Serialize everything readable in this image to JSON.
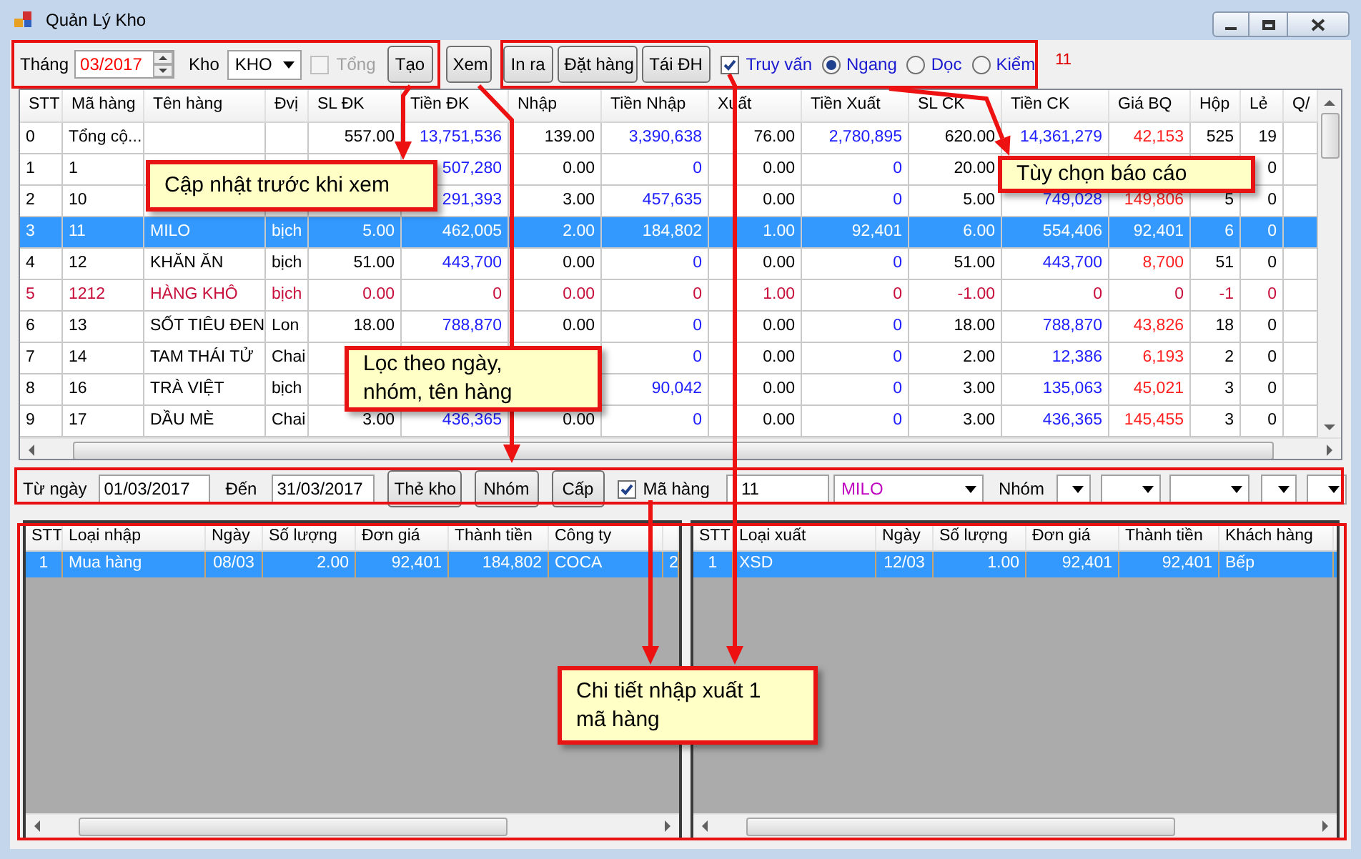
{
  "window": {
    "title": "Quản Lý Kho"
  },
  "toolbar": {
    "month_label": "Tháng",
    "month_value": "03/2017",
    "store_label": "Kho",
    "store_value": "KHO",
    "total": {
      "label": "Tổng",
      "checked": false,
      "disabled": true
    },
    "buttons": [
      "Tạo",
      "Xem",
      "In ra",
      "Đặt hàng",
      "Tái ĐH"
    ],
    "query": {
      "label": "Truy vấn",
      "checked": true
    },
    "layout_options": [
      {
        "label": "Ngang",
        "selected": true
      },
      {
        "label": "Dọc",
        "selected": false
      },
      {
        "label": "Kiểm",
        "selected": false
      }
    ],
    "count": "11"
  },
  "main_table": {
    "columns": [
      {
        "label": "STT",
        "kind": "index"
      },
      {
        "label": "Mã hàng",
        "kind": "text"
      },
      {
        "label": "Tên hàng",
        "kind": "text"
      },
      {
        "label": "Đvị",
        "kind": "text"
      },
      {
        "label": "SL ĐK",
        "kind": "qty"
      },
      {
        "label": "Tiền ĐK",
        "kind": "money"
      },
      {
        "label": "Nhập",
        "kind": "qty"
      },
      {
        "label": "Tiền Nhập",
        "kind": "money"
      },
      {
        "label": "Xuất",
        "kind": "qty"
      },
      {
        "label": "Tiền Xuất",
        "kind": "money"
      },
      {
        "label": "SL CK",
        "kind": "qty"
      },
      {
        "label": "Tiền CK",
        "kind": "money"
      },
      {
        "label": "Giá BQ",
        "kind": "price"
      },
      {
        "label": "Hộp",
        "kind": "qty"
      },
      {
        "label": "Lẻ",
        "kind": "qty"
      },
      {
        "label": "Q/",
        "kind": "text"
      }
    ],
    "rows": [
      {
        "selected": false,
        "kind": "normal",
        "cells": [
          "0",
          "Tổng cộ...",
          null,
          null,
          "557.00",
          "13,751,536",
          "139.00",
          "3,390,638",
          "76.00",
          "2,780,895",
          "620.00",
          "14,361,279",
          "42,153",
          "525",
          "19"
        ]
      },
      {
        "selected": false,
        "kind": "normal",
        "cells": [
          "1",
          "1",
          null,
          null,
          null,
          "507,280",
          "0.00",
          "0",
          "0.00",
          "0",
          "20.00",
          null,
          null,
          null,
          "0"
        ]
      },
      {
        "selected": false,
        "kind": "normal",
        "cells": [
          "2",
          "10",
          null,
          null,
          null,
          "291,393",
          "3.00",
          "457,635",
          "0.00",
          "0",
          "5.00",
          "749,028",
          "149,806",
          "5",
          "0"
        ]
      },
      {
        "selected": true,
        "kind": "normal",
        "cells": [
          "3",
          "11",
          "MILO",
          "bịch",
          "5.00",
          "462,005",
          "2.00",
          "184,802",
          "1.00",
          "92,401",
          "6.00",
          "554,406",
          "92,401",
          "6",
          "0"
        ]
      },
      {
        "selected": false,
        "kind": "normal",
        "cells": [
          "4",
          "12",
          "KHĂN ĂN",
          "bịch",
          "51.00",
          "443,700",
          "0.00",
          "0",
          "0.00",
          "0",
          "51.00",
          "443,700",
          "8,700",
          "51",
          "0"
        ]
      },
      {
        "selected": false,
        "kind": "alert",
        "cells": [
          "5",
          "1212",
          "HÀNG KHÔ",
          "bịch",
          "0.00",
          "0",
          "0.00",
          "0",
          "1.00",
          "0",
          "-1.00",
          "0",
          "0",
          "-1",
          "0"
        ]
      },
      {
        "selected": false,
        "kind": "normal",
        "cells": [
          "6",
          "13",
          "SỐT TIÊU ĐEN",
          "Lon",
          "18.00",
          "788,870",
          "0.00",
          "0",
          "0.00",
          "0",
          "18.00",
          "788,870",
          "43,826",
          "18",
          "0"
        ]
      },
      {
        "selected": false,
        "kind": "normal",
        "cells": [
          "7",
          "14",
          "TAM THÁI TỬ",
          "Chai",
          null,
          null,
          null,
          "0",
          "0.00",
          "0",
          "2.00",
          "12,386",
          "6,193",
          "2",
          "0"
        ]
      },
      {
        "selected": false,
        "kind": "normal",
        "cells": [
          "8",
          "16",
          "TRÀ VIỆT",
          "bịch",
          null,
          null,
          null,
          "90,042",
          "0.00",
          "0",
          "3.00",
          "135,063",
          "45,021",
          "3",
          "0"
        ]
      },
      {
        "selected": false,
        "kind": "normal",
        "cells": [
          "9",
          "17",
          "DẦU MÈ",
          "Chai",
          "3.00",
          "436,365",
          "0.00",
          "0",
          "0.00",
          "0",
          "3.00",
          "436,365",
          "145,455",
          "3",
          "0"
        ]
      }
    ]
  },
  "filter_bar": {
    "from_label": "Từ ngày",
    "from_value": "01/03/2017",
    "to_label": "Đến",
    "to_value": "31/03/2017",
    "buttons": [
      "Thẻ kho",
      "Nhóm",
      "Cấp"
    ],
    "item_filter": {
      "label": "Mã hàng",
      "checked": true
    },
    "item_code": "11",
    "item_name": "MILO",
    "group_label": "Nhóm"
  },
  "import_table": {
    "columns": [
      {
        "label": "STT",
        "kind": "index"
      },
      {
        "label": "Loại nhập",
        "kind": "text"
      },
      {
        "label": "Ngày",
        "kind": "date"
      },
      {
        "label": "Số lượng",
        "kind": "num"
      },
      {
        "label": "Đơn giá",
        "kind": "num"
      },
      {
        "label": "Thành tiền",
        "kind": "num"
      },
      {
        "label": "Công ty",
        "kind": "text"
      },
      {
        "kind": "text"
      }
    ],
    "rows": [
      {
        "selected": true,
        "cells": [
          "1",
          "Mua hàng",
          "08/03",
          "2.00",
          "92,401",
          "184,802",
          "COCA",
          "2"
        ]
      }
    ]
  },
  "export_table": {
    "columns": [
      {
        "label": "STT",
        "kind": "index"
      },
      {
        "label": "Loại xuất",
        "kind": "text"
      },
      {
        "label": "Ngày",
        "kind": "date"
      },
      {
        "label": "Số lượng",
        "kind": "num"
      },
      {
        "label": "Đơn giá",
        "kind": "num"
      },
      {
        "label": "Thành tiền",
        "kind": "num"
      },
      {
        "label": "Khách hàng",
        "kind": "text"
      }
    ],
    "rows": [
      {
        "selected": true,
        "cells": [
          "1",
          "XSD",
          "12/03",
          "1.00",
          "92,401",
          "92,401",
          "Bếp"
        ]
      }
    ]
  },
  "annotations": [
    {
      "text": "Cập nhật trước khi xem"
    },
    {
      "text": "Tùy chọn báo cáo"
    },
    {
      "text": "Lọc theo ngày,\nnhóm, tên hàng"
    },
    {
      "text": "Chi tiết nhập xuất 1\nmã hàng"
    }
  ]
}
